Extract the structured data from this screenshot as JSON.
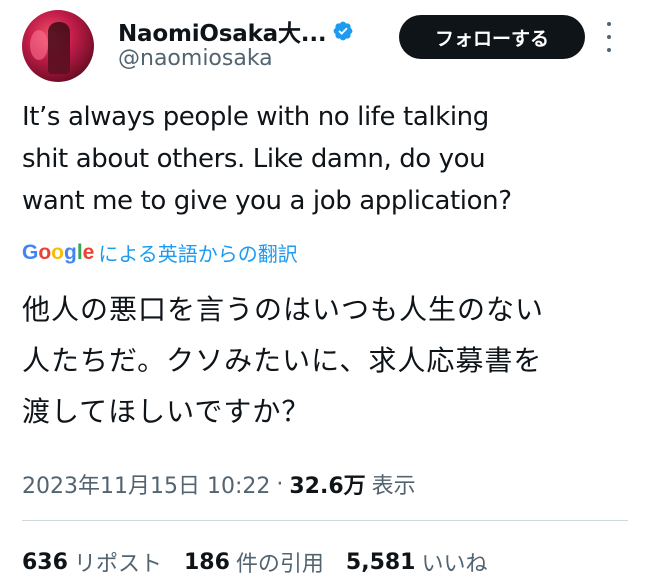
{
  "author": {
    "display_name": "NaomiOsaka大...",
    "handle": "@naomiosaka",
    "verified_icon": "verified-badge-icon",
    "avatar": "profile-photo"
  },
  "actions": {
    "follow_label": "フォローする",
    "more_icon": "more-vertical-icon"
  },
  "tweet": {
    "text": "It’s always people with no life talking\nshit about others. Like damn, do you\nwant me to give you a job application?",
    "translation_provider": "Google",
    "translation_label": "による英語からの翻訳",
    "translated_text": "他人の悪口を言うのはいつも人生のない\n人たちだ。クソみたいに、求人応募書を\n渡してほしいですか？"
  },
  "meta": {
    "timestamp": "2023年11月15日 10:22",
    "separator": "·",
    "views_count": "32.6万",
    "views_label": "表示"
  },
  "stats": [
    {
      "count": "636",
      "label": "リポスト"
    },
    {
      "count": "186",
      "label": "件の引用"
    },
    {
      "count": "5,581",
      "label": "いいね"
    }
  ],
  "colors": {
    "accent": "#1d9bf0",
    "text": "#0f1419",
    "secondary": "#536471",
    "button_bg": "#0f1419",
    "divider": "#cfd9de"
  }
}
